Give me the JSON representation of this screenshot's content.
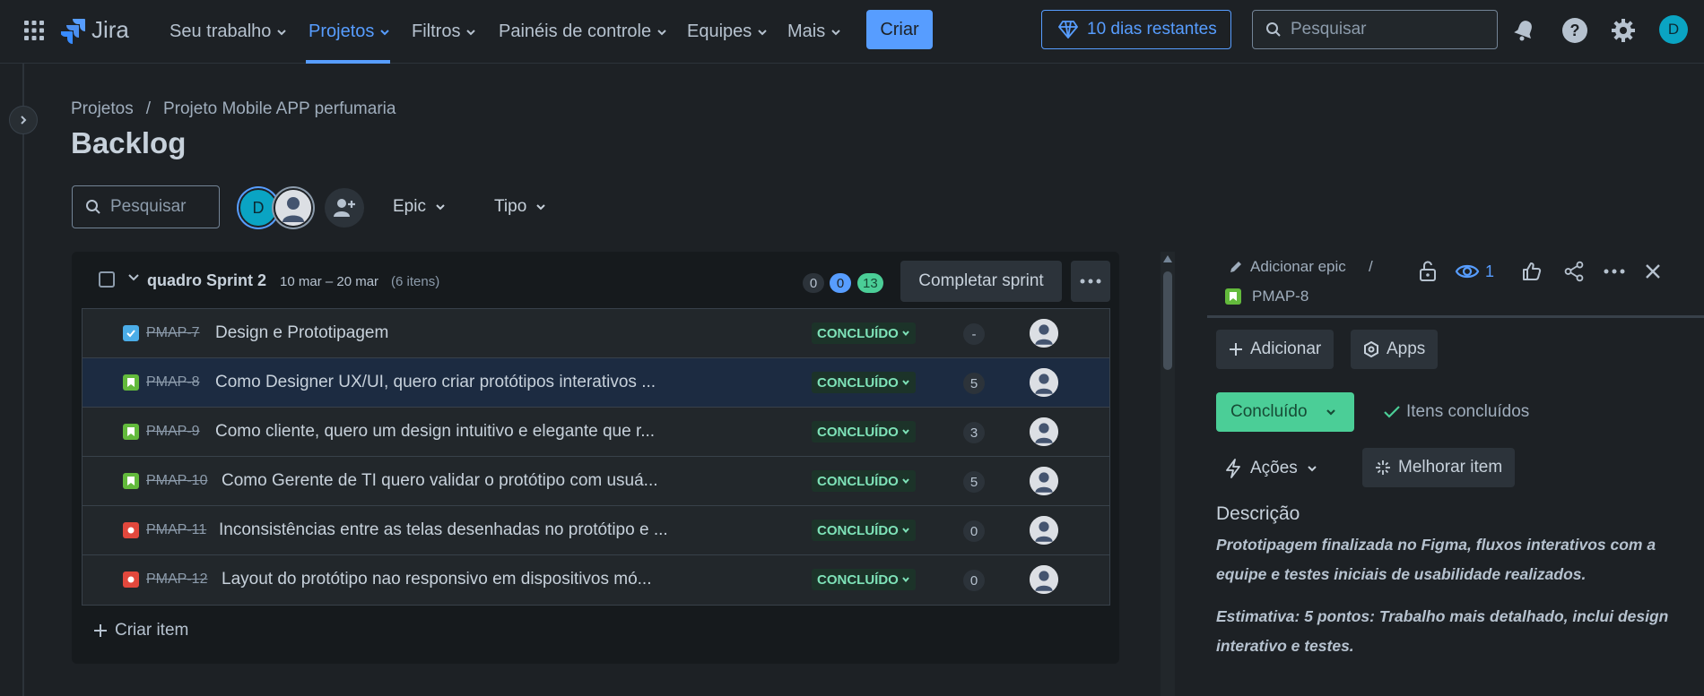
{
  "topnav": {
    "logo": "Jira",
    "items": [
      {
        "label": "Seu trabalho"
      },
      {
        "label": "Projetos"
      },
      {
        "label": "Filtros"
      },
      {
        "label": "Painéis de controle"
      },
      {
        "label": "Equipes"
      },
      {
        "label": "Mais"
      }
    ],
    "create_label": "Criar",
    "trial_label": "10 dias restantes",
    "search_placeholder": "Pesquisar",
    "user_initial": "D"
  },
  "breadcrumb": {
    "root": "Projetos",
    "separator": "/",
    "project": "Projeto Mobile APP perfumaria"
  },
  "page_title": "Backlog",
  "filters": {
    "search_placeholder": "Pesquisar",
    "avatar_initial": "D",
    "epic_label": "Epic",
    "type_label": "Tipo"
  },
  "sprint": {
    "name": "quadro Sprint 2",
    "dates": "10 mar – 20 mar",
    "count": "(6 itens)",
    "counters": {
      "todo": "0",
      "in_progress": "0",
      "done": "13"
    },
    "complete_label": "Completar sprint",
    "create_item_label": "Criar item",
    "rows": [
      {
        "key": "PMAP-7",
        "type": "task",
        "summary": "Design e Prototipagem",
        "status": "CONCLUÍDO",
        "estimate": "-"
      },
      {
        "key": "PMAP-8",
        "type": "story",
        "summary": "Como Designer UX/UI, quero criar protótipos interativos ...",
        "status": "CONCLUÍDO",
        "estimate": "5"
      },
      {
        "key": "PMAP-9",
        "type": "story",
        "summary": "Como cliente, quero um design intuitivo e elegante que r...",
        "status": "CONCLUÍDO",
        "estimate": "3"
      },
      {
        "key": "PMAP-10",
        "type": "story",
        "summary": "Como Gerente de TI quero validar o protótipo com usuá...",
        "status": "CONCLUÍDO",
        "estimate": "5"
      },
      {
        "key": "PMAP-11",
        "type": "bug",
        "summary": "Inconsistências entre as telas desenhadas no protótipo e ...",
        "status": "CONCLUÍDO",
        "estimate": "0"
      },
      {
        "key": "PMAP-12",
        "type": "bug",
        "summary": "Layout do protótipo nao responsivo em dispositivos mó...",
        "status": "CONCLUÍDO",
        "estimate": "0"
      }
    ]
  },
  "detail": {
    "add_epic": "Adicionar epic",
    "separator": "/",
    "key": "PMAP-8",
    "watchers": "1",
    "add_label": "Adicionar",
    "apps_label": "Apps",
    "status_label": "Concluído",
    "done_items_label": "Itens concluídos",
    "actions_label": "Ações",
    "improve_label": "Melhorar item",
    "description_title": "Descrição",
    "description_p1": "Prototipagem finalizada no Figma, fluxos interativos com a equipe e testes iniciais de usabilidade realizados.",
    "description_p2": "Estimativa: 5 pontos: Trabalho mais detalhado, inclui design interativo e testes."
  },
  "colors": {
    "accent": "#579dff",
    "done_green": "#4bce97",
    "story_green": "#63ba3c",
    "bug_red": "#e2483d",
    "task_blue": "#4bade8"
  }
}
